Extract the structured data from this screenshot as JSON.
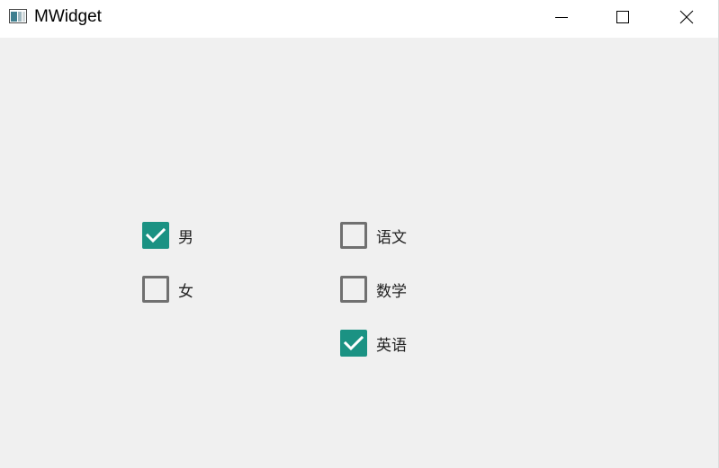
{
  "window": {
    "title": "MWidget",
    "icon": "app-window-icon",
    "controls": [
      "minimize-icon",
      "maximize-icon",
      "close-icon"
    ]
  },
  "gender_group": {
    "options": [
      {
        "label": "男",
        "checked": true
      },
      {
        "label": "女",
        "checked": false
      }
    ]
  },
  "subject_group": {
    "options": [
      {
        "label": "语文",
        "checked": false
      },
      {
        "label": "数学",
        "checked": false
      },
      {
        "label": "英语",
        "checked": true
      }
    ]
  },
  "colors": {
    "checked_fill": "#1b9283",
    "unchecked_border": "#707070",
    "background": "#f0f0f0"
  }
}
